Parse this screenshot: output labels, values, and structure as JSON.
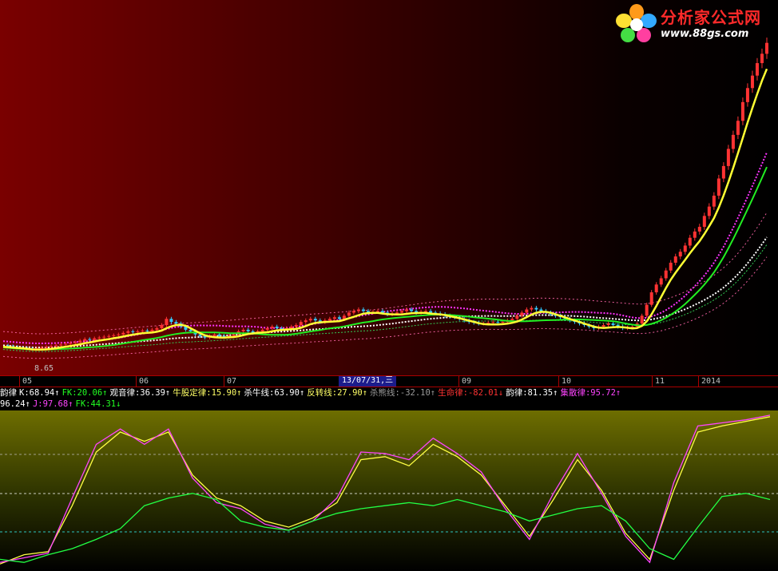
{
  "logo": {
    "name": "分析家公式网",
    "url": "www.88gs.com"
  },
  "price_low_label": "8.65",
  "date_axis": {
    "ticks": [
      "05",
      "06",
      "07",
      "09",
      "10",
      "11",
      "2014"
    ],
    "cursor_label": "13/07/31,三"
  },
  "legend_row1": [
    {
      "text": "韵律",
      "color": "#ffffff"
    },
    {
      "text": "K:68.94↑",
      "color": "#ffffff"
    },
    {
      "text": "FK:20.06↑",
      "color": "#22ff22"
    },
    {
      "text": "观音律:36.39↑",
      "color": "#ffffff"
    },
    {
      "text": "牛股定律:15.90↑",
      "color": "#ffff66"
    },
    {
      "text": "杀牛线:63.90↑",
      "color": "#ffffff"
    },
    {
      "text": "反转线:27.90↑",
      "color": "#ffff66"
    },
    {
      "text": "杀熊线:-32.10↑",
      "color": "#9a9a9a"
    },
    {
      "text": "生命律:-82.01↓",
      "color": "#ff3333"
    },
    {
      "text": "韵律:81.35↑",
      "color": "#ffffff"
    },
    {
      "text": "集散律:95.72↑",
      "color": "#ff44ff"
    }
  ],
  "legend_row2": [
    {
      "text": "96.24↑",
      "color": "#ffffff"
    },
    {
      "text": "J:97.68↑",
      "color": "#ff44ff"
    },
    {
      "text": "FK:44.31↓",
      "color": "#22ff22"
    }
  ],
  "colors": {
    "up_candle": "#ff3333",
    "down_candle": "#33ccff",
    "ma_yellow": "#ffff33",
    "ma_green": "#22ee22",
    "band_pink": "#ff66aa",
    "band_magenta": "#ff33ff",
    "dot_white": "#ffffff",
    "osc_k": "#ffff44",
    "osc_j": "#ff44ff",
    "osc_fk": "#22ff44"
  },
  "chart_data": [
    {
      "type": "candlestick",
      "title": "",
      "x": [
        0,
        6,
        12,
        18,
        24,
        30,
        36,
        42,
        48,
        54,
        60,
        66,
        72,
        78,
        84,
        90,
        96,
        102,
        108,
        114,
        120,
        126,
        132,
        138,
        144,
        150,
        156,
        162,
        168,
        174,
        180,
        186,
        192,
        198,
        204,
        210,
        216,
        222,
        228,
        234,
        240,
        246,
        252,
        258,
        264,
        270,
        276,
        282,
        288,
        294,
        300,
        306,
        312,
        318,
        324,
        330,
        336,
        342,
        348,
        354,
        360,
        366,
        372,
        378,
        384,
        390,
        396,
        402,
        408,
        414,
        420,
        426,
        432,
        438,
        444,
        450,
        456,
        462,
        468,
        474,
        480,
        486,
        492,
        498,
        504,
        510,
        516,
        522,
        528,
        534,
        540,
        546,
        552,
        558,
        564,
        570,
        576,
        582,
        588,
        594,
        600,
        606,
        612,
        618,
        624,
        630,
        636,
        642,
        648,
        654,
        660,
        666,
        672,
        678,
        684,
        690,
        696,
        702,
        708,
        714,
        720,
        726,
        732,
        738,
        744,
        750,
        756,
        762,
        768,
        774,
        780,
        786,
        792,
        798,
        804,
        810,
        816,
        822,
        828,
        834,
        840,
        846,
        852,
        858,
        864,
        870,
        876,
        882,
        888,
        894,
        900,
        906,
        912,
        918,
        924,
        930,
        936,
        942,
        948,
        954,
        960
      ],
      "close": [
        8.9,
        8.85,
        8.8,
        8.75,
        8.72,
        8.7,
        8.68,
        8.7,
        8.75,
        8.8,
        8.85,
        8.9,
        8.95,
        9.0,
        9.05,
        9.1,
        9.2,
        9.3,
        9.25,
        9.35,
        9.4,
        9.45,
        9.5,
        9.55,
        9.6,
        9.7,
        9.8,
        9.75,
        9.8,
        9.85,
        9.8,
        9.9,
        10.0,
        10.2,
        10.6,
        10.4,
        10.3,
        10.1,
        9.9,
        9.8,
        9.6,
        9.5,
        9.4,
        9.5,
        9.6,
        9.5,
        9.45,
        9.5,
        9.6,
        9.8,
        9.9,
        9.8,
        9.7,
        9.8,
        9.9,
        10.0,
        10.1,
        10.0,
        9.95,
        10.0,
        10.1,
        10.2,
        10.4,
        10.5,
        10.6,
        10.5,
        10.4,
        10.5,
        10.6,
        10.7,
        10.6,
        10.8,
        11.0,
        11.1,
        11.2,
        11.1,
        11.0,
        11.05,
        11.1,
        11.0,
        10.9,
        10.95,
        11.0,
        11.1,
        11.2,
        11.1,
        11.0,
        11.05,
        11.1,
        11.0,
        10.95,
        10.9,
        10.8,
        10.75,
        10.7,
        10.6,
        10.5,
        10.4,
        10.35,
        10.3,
        10.3,
        10.35,
        10.4,
        10.35,
        10.4,
        10.5,
        10.6,
        10.8,
        11.0,
        11.2,
        11.3,
        11.2,
        11.1,
        11.0,
        10.9,
        10.8,
        10.7,
        10.6,
        10.5,
        10.4,
        10.3,
        10.2,
        10.1,
        10.0,
        10.1,
        10.2,
        10.3,
        10.2,
        10.1,
        10.0,
        10.05,
        10.1,
        10.3,
        10.8,
        11.5,
        12.3,
        12.8,
        13.2,
        13.7,
        14.2,
        14.6,
        14.9,
        15.3,
        15.8,
        16.2,
        16.5,
        17.2,
        17.8,
        18.5,
        19.6,
        20.4,
        21.5,
        22.4,
        23.3,
        24.5,
        25.4,
        26.2,
        27.0,
        27.6,
        28.3
      ],
      "ylim": [
        8.0,
        29.0
      ]
    },
    {
      "type": "line",
      "title": "",
      "ylim": [
        0,
        100
      ],
      "x": [
        0,
        30,
        60,
        90,
        120,
        150,
        180,
        210,
        240,
        270,
        300,
        330,
        360,
        390,
        420,
        450,
        480,
        510,
        540,
        570,
        600,
        630,
        660,
        690,
        720,
        750,
        780,
        810,
        840,
        870,
        900,
        930,
        960
      ],
      "series": [
        {
          "name": "K",
          "values": [
            2,
            8,
            10,
            40,
            75,
            88,
            82,
            88,
            60,
            45,
            40,
            30,
            26,
            32,
            42,
            70,
            72,
            66,
            80,
            72,
            60,
            40,
            20,
            44,
            70,
            50,
            22,
            5,
            50,
            88,
            92,
            95,
            98
          ]
        },
        {
          "name": "J",
          "values": [
            3,
            6,
            9,
            45,
            80,
            90,
            80,
            90,
            58,
            42,
            38,
            28,
            24,
            30,
            45,
            75,
            74,
            70,
            84,
            74,
            62,
            38,
            18,
            48,
            74,
            48,
            20,
            3,
            55,
            92,
            94,
            96,
            99
          ]
        },
        {
          "name": "FK",
          "values": [
            5,
            3,
            8,
            12,
            18,
            25,
            40,
            45,
            48,
            44,
            30,
            26,
            24,
            30,
            35,
            38,
            40,
            42,
            40,
            44,
            40,
            36,
            30,
            34,
            38,
            40,
            30,
            12,
            5,
            26,
            46,
            48,
            44
          ]
        }
      ]
    }
  ]
}
